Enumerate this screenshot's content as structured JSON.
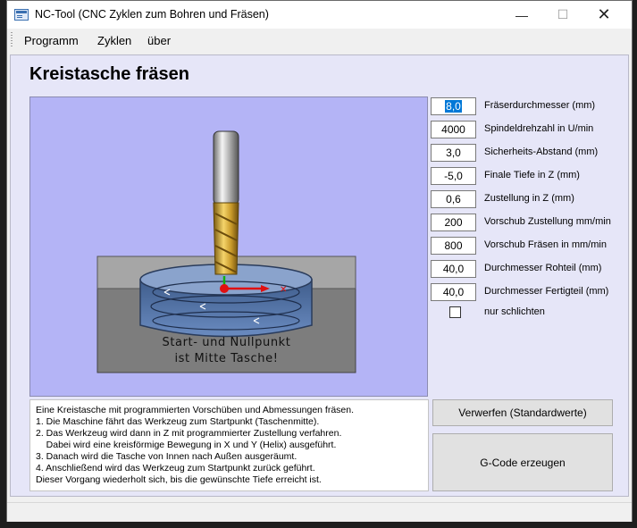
{
  "window": {
    "title": "NC-Tool (CNC Zyklen zum Bohren und Fräsen)",
    "min_glyph": "—",
    "max_glyph": "☐",
    "close_glyph": "✕"
  },
  "menu": {
    "items": [
      "Programm",
      "Zyklen",
      "über"
    ]
  },
  "heading": "Kreistasche fräsen",
  "illustration": {
    "caption_line1": "Start- und Nullpunkt",
    "caption_line2": "ist Mitte Tasche!"
  },
  "params": [
    {
      "value": "8,0",
      "label": "Fräserdurchmesser (mm)",
      "selected": true
    },
    {
      "value": "4000",
      "label": "Spindeldrehzahl in U/min"
    },
    {
      "value": "3,0",
      "label": "Sicherheits-Abstand (mm)"
    },
    {
      "value": "-5,0",
      "label": "Finale Tiefe in Z (mm)"
    },
    {
      "value": "0,6",
      "label": "Zustellung in Z (mm)"
    },
    {
      "value": "200",
      "label": "Vorschub Zustellung mm/min"
    },
    {
      "value": "800",
      "label": "Vorschub Fräsen in mm/min"
    },
    {
      "value": "40,0",
      "label": "Durchmesser Rohteil (mm)"
    },
    {
      "value": "40,0",
      "label": "Durchmesser Fertigteil (mm)"
    }
  ],
  "finish_only": {
    "label": "nur schlichten",
    "checked": false
  },
  "description": [
    "Eine Kreistasche mit programmierten Vorschüben und Abmessungen fräsen.",
    "1. Die Maschine fährt das Werkzeug zum Startpunkt (Taschenmitte).",
    "2. Das Werkzeug wird dann in Z mit programmierter Zustellung verfahren.",
    "    Dabei wird eine kreisförmige Bewegung in X und Y (Helix) ausgeführt.",
    "3. Danach wird die Tasche von Innen nach Außen ausgeräumt.",
    "4. Anschließend wird das Werkzeug zum Startpunkt zurück geführt.",
    "Dieser Vorgang wiederholt sich, bis die gewünschte Tiefe erreicht ist."
  ],
  "buttons": {
    "reset": "Verwerfen (Standardwerte)",
    "generate": "G-Code erzeugen"
  },
  "colors": {
    "panel_bg": "#e6e6f8",
    "picture_bg": "#b4b4f6",
    "selection": "#0078d7"
  }
}
